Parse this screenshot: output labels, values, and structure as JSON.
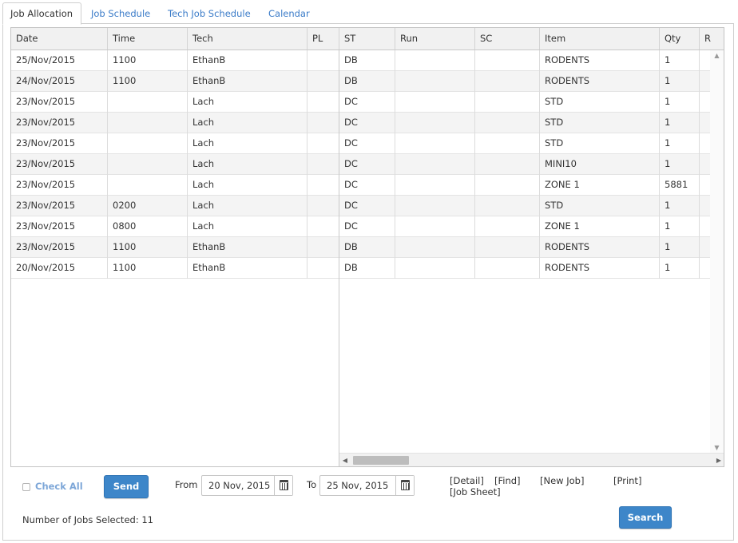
{
  "tabs": [
    {
      "label": "Job Allocation"
    },
    {
      "label": "Job Schedule"
    },
    {
      "label": "Tech Job Schedule"
    },
    {
      "label": "Calendar"
    }
  ],
  "grid": {
    "columns": [
      "Date",
      "Time",
      "Tech",
      "PL",
      "ST",
      "Run",
      "SC",
      "Item",
      "Qty",
      "R"
    ],
    "rows": [
      [
        "25/Nov/2015",
        "1100",
        "EthanB",
        "",
        "DB",
        "",
        "",
        "RODENTS",
        "1"
      ],
      [
        "24/Nov/2015",
        "1100",
        "EthanB",
        "",
        "DB",
        "",
        "",
        "RODENTS",
        "1"
      ],
      [
        "23/Nov/2015",
        "",
        "Lach",
        "",
        "DC",
        "",
        "",
        "STD",
        "1"
      ],
      [
        "23/Nov/2015",
        "",
        "Lach",
        "",
        "DC",
        "",
        "",
        "STD",
        "1"
      ],
      [
        "23/Nov/2015",
        "",
        "Lach",
        "",
        "DC",
        "",
        "",
        "STD",
        "1"
      ],
      [
        "23/Nov/2015",
        "",
        "Lach",
        "",
        "DC",
        "",
        "",
        "MINI10",
        "1"
      ],
      [
        "23/Nov/2015",
        "",
        "Lach",
        "",
        "DC",
        "",
        "",
        "ZONE 1",
        "5881"
      ],
      [
        "23/Nov/2015",
        "0200",
        "Lach",
        "",
        "DC",
        "",
        "",
        "STD",
        "1"
      ],
      [
        "23/Nov/2015",
        "0800",
        "Lach",
        "",
        "DC",
        "",
        "",
        "ZONE 1",
        "1"
      ],
      [
        "23/Nov/2015",
        "1100",
        "EthanB",
        "",
        "DB",
        "",
        "",
        "RODENTS",
        "1"
      ],
      [
        "20/Nov/2015",
        "1100",
        "EthanB",
        "",
        "DB",
        "",
        "",
        "RODENTS",
        "1"
      ]
    ]
  },
  "controls": {
    "check_all_label": "Check All",
    "send_label": "Send",
    "from_label": "From",
    "from_value": "20 Nov, 2015",
    "to_label": "To",
    "to_value": "25 Nov, 2015",
    "links": {
      "detail": "[Detail]",
      "find": "[Find]",
      "new_job": "[New Job]",
      "print": "[Print]",
      "job_sheet": "[Job Sheet]"
    },
    "search_label": "Search",
    "jobs_selected": "Number of Jobs Selected: 11"
  }
}
